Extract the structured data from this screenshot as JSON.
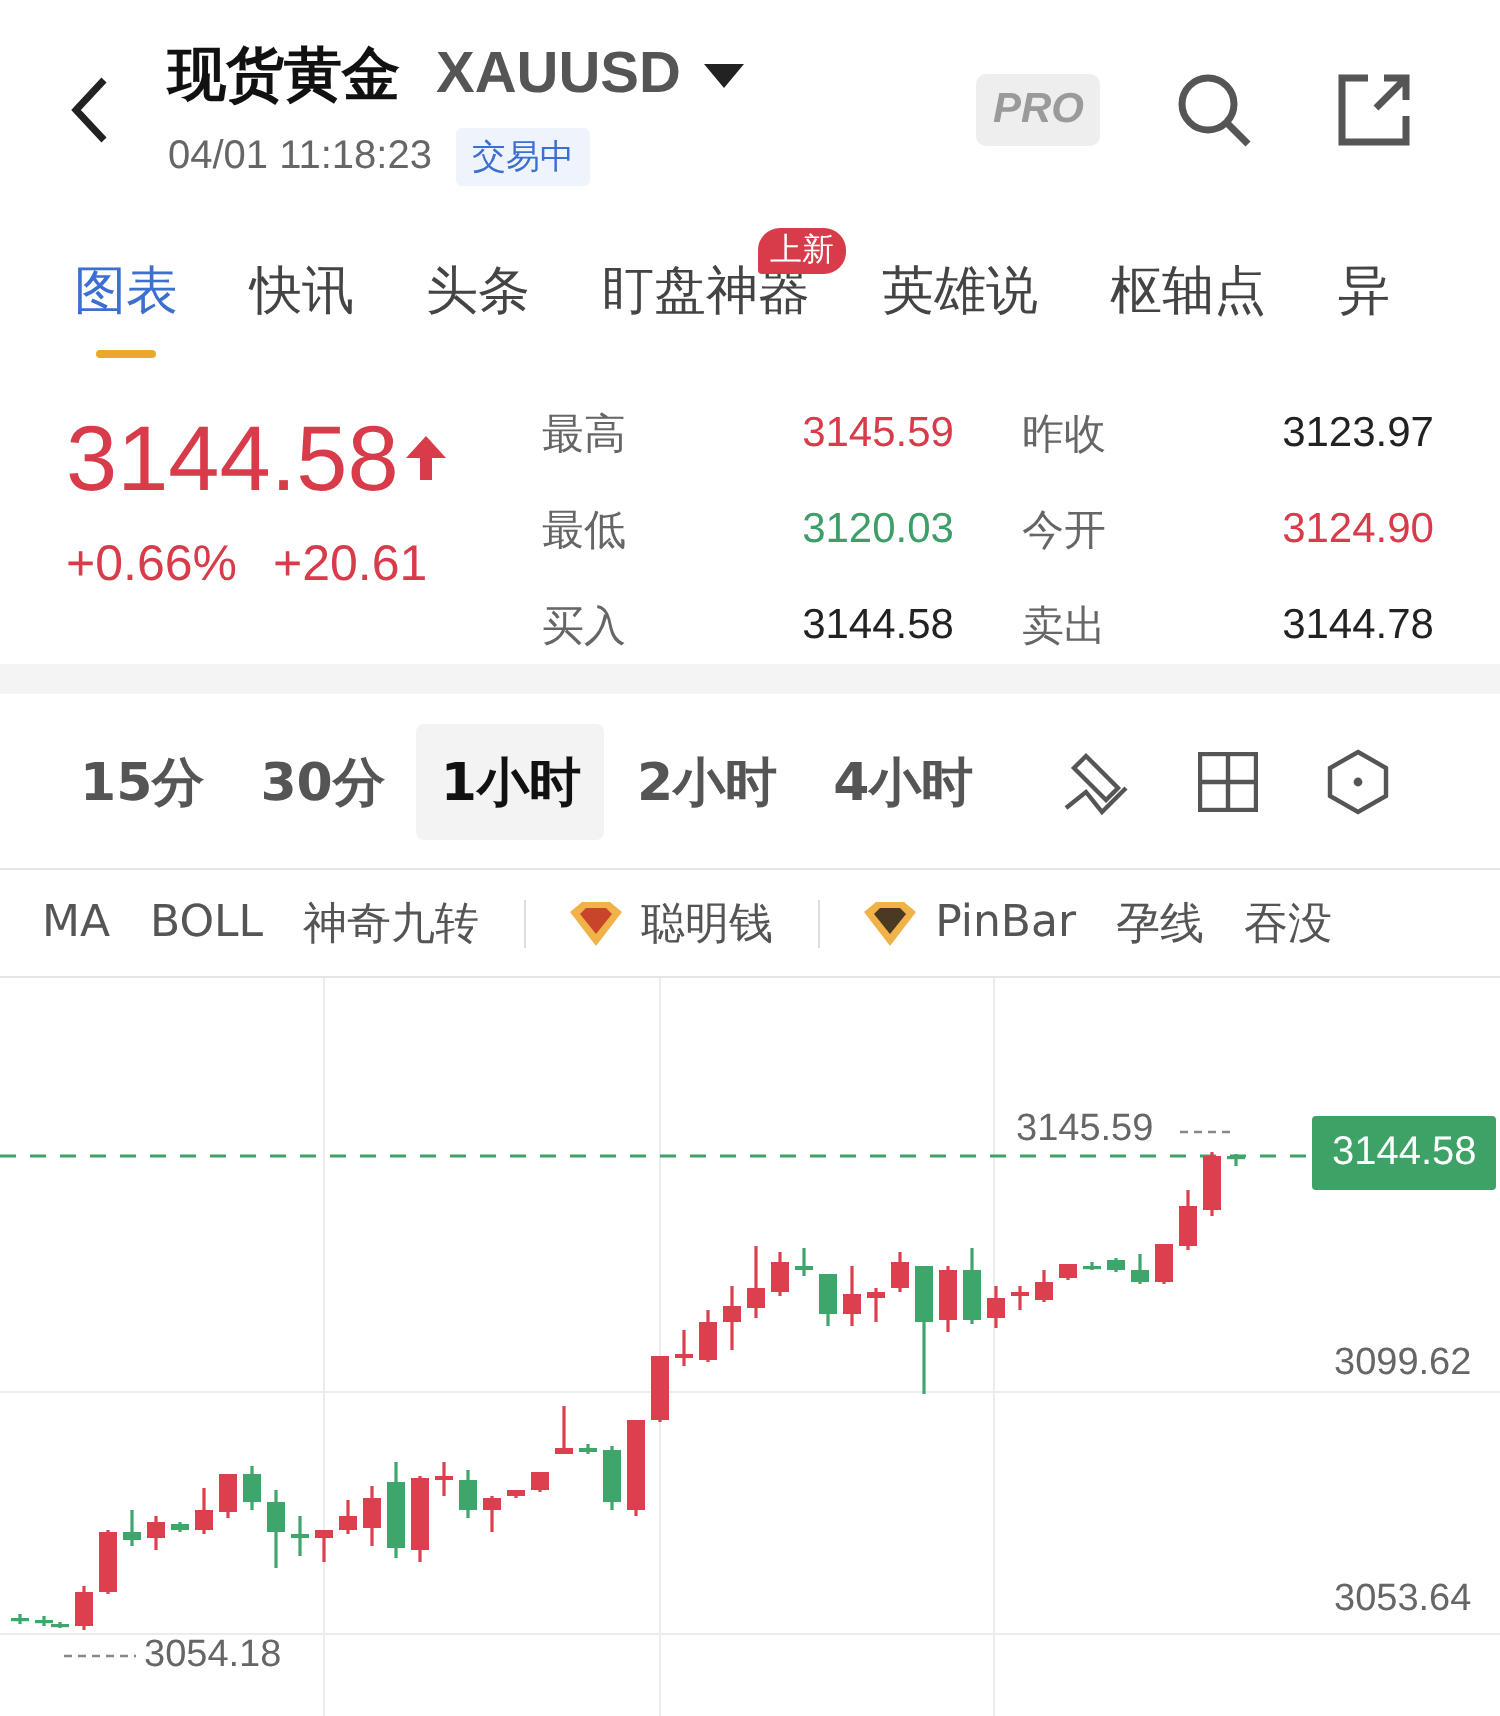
{
  "header": {
    "title": "现货黄金",
    "symbol": "XAUUSD",
    "time": "04/01 11:18:23",
    "status": "交易中",
    "pro": "PRO"
  },
  "tabs": [
    {
      "label": "图表",
      "selected": true
    },
    {
      "label": "快讯",
      "selected": false
    },
    {
      "label": "头条",
      "selected": false
    },
    {
      "label": "盯盘神器",
      "selected": false,
      "badge": "上新"
    },
    {
      "label": "英雄说",
      "selected": false
    },
    {
      "label": "枢轴点",
      "selected": false
    },
    {
      "label": "异",
      "selected": false
    }
  ],
  "quote": {
    "price": "3144.58",
    "rising": true,
    "change_pct": "+0.66%",
    "change": "+20.61",
    "stats": [
      {
        "label": "最高",
        "value": "3145.59",
        "color": "#d83c4b"
      },
      {
        "label": "昨收",
        "value": "3123.97",
        "color": "#222222"
      },
      {
        "label": "最低",
        "value": "3120.03",
        "color": "#3e9e68"
      },
      {
        "label": "今开",
        "value": "3124.90",
        "color": "#d83c4b"
      },
      {
        "label": "买入",
        "value": "3144.58",
        "color": "#222222"
      },
      {
        "label": "卖出",
        "value": "3144.78",
        "color": "#222222"
      }
    ]
  },
  "periods": [
    {
      "label": "15分",
      "selected": false
    },
    {
      "label": "30分",
      "selected": false
    },
    {
      "label": "1小时",
      "selected": true
    },
    {
      "label": "2小时",
      "selected": false
    },
    {
      "label": "4小时",
      "selected": false
    }
  ],
  "indicators": [
    {
      "label": "MA",
      "kind": "plain"
    },
    {
      "label": "BOLL",
      "kind": "plain"
    },
    {
      "label": "神奇九转",
      "kind": "plain"
    },
    {
      "label": "聪明钱",
      "kind": "gem",
      "color": "#c8452c"
    },
    {
      "label": "PinBar",
      "kind": "gem",
      "color": "#4a3a22"
    },
    {
      "label": "孕线",
      "kind": "plain"
    },
    {
      "label": "吞没",
      "kind": "plain"
    }
  ],
  "chart": {
    "high_label": "3145.59",
    "last_price": "3144.58",
    "axis_labels": [
      "3099.62",
      "3053.64"
    ],
    "low_label": "3054.18"
  }
}
